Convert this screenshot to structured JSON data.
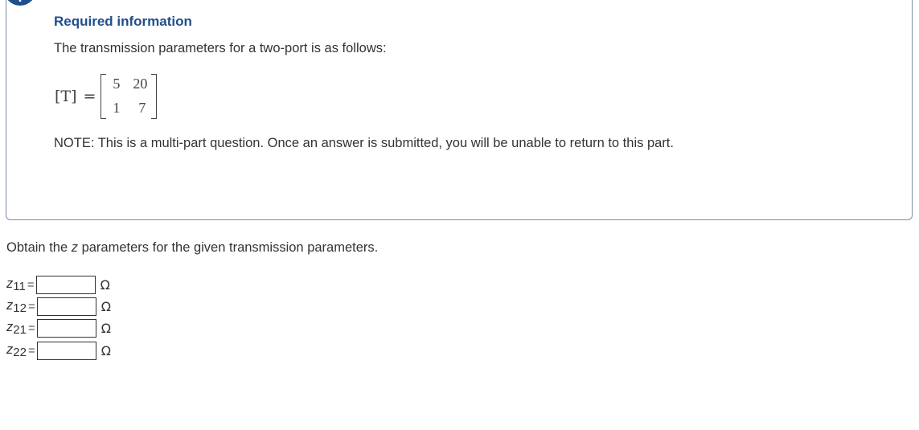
{
  "info": {
    "icon": "!",
    "title": "Required information",
    "intro": "The transmission parameters for a two-port is as follows:",
    "matrix": {
      "label": "[T]",
      "equals": "=",
      "rows": [
        [
          "5",
          "20"
        ],
        [
          "1",
          "7"
        ]
      ]
    },
    "note": "NOTE: This is a multi-part question. Once an answer is submitted, you will be unable to return to this part."
  },
  "question": {
    "prefix": "Obtain the ",
    "variable": "z",
    "suffix": " parameters for the given transmission parameters."
  },
  "answers": [
    {
      "var": "z",
      "sub": "11",
      "equals": "=",
      "value": "",
      "unit": "Ω"
    },
    {
      "var": "z",
      "sub": "12",
      "equals": "=",
      "value": "",
      "unit": "Ω"
    },
    {
      "var": "z",
      "sub": "21",
      "equals": "=",
      "value": "",
      "unit": "Ω"
    },
    {
      "var": "z",
      "sub": "22",
      "equals": "=",
      "value": "",
      "unit": "Ω"
    }
  ],
  "colors": {
    "accent": "#1e4f8c",
    "box_border": "#7a8fa6",
    "text": "#333333"
  }
}
